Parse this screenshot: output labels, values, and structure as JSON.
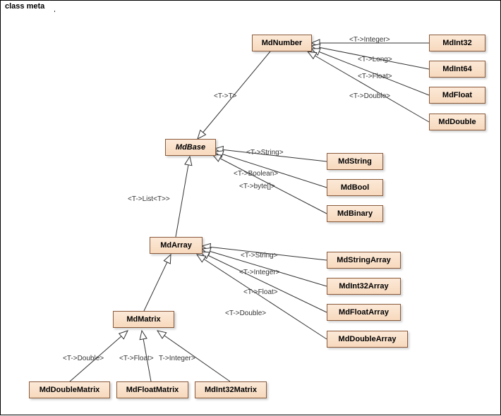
{
  "frame": {
    "title": "class meta"
  },
  "classes": {
    "mdnumber": "MdNumber",
    "mdint32": "MdInt32",
    "mdint64": "MdInt64",
    "mdfloat": "MdFloat",
    "mddouble": "MdDouble",
    "mdbase": "MdBase",
    "mdstring": "MdString",
    "mdbool": "MdBool",
    "mdbinary": "MdBinary",
    "mdarray": "MdArray",
    "mdstringarray": "MdStringArray",
    "mdint32array": "MdInt32Array",
    "mdfloatarray": "MdFloatArray",
    "mddoublearray": "MdDoubleArray",
    "mdmatrix": "MdMatrix",
    "mddoublematrix": "MdDoubleMatrix",
    "mdfloatmatrix": "MdFloatMatrix",
    "mdint32matrix": "MdInt32Matrix"
  },
  "labels": {
    "t_integer": "<T->Integer>",
    "t_long": "<T->Long>",
    "t_float": "<T->Float>",
    "t_double": "<T->Double>",
    "t_t": "<T->T>",
    "t_string": "<T->String>",
    "t_boolean": "<T->Boolean>",
    "t_byte": "<T->byte[]>",
    "t_list_t": "<T->List<T>>",
    "t_string2": "<T->String>",
    "t_integer2": "<T->Integer>",
    "t_float2": "<T->Float>",
    "t_double2": "<T->Double>",
    "t_double3": "<T->Double>",
    "t_float3": "<T->Float>",
    "t_integer3": "T->Integer>"
  },
  "chart_data": {
    "type": "diagram",
    "diagram_type": "uml_class",
    "title": "class meta",
    "nodes": [
      {
        "id": "MdBase",
        "abstract": true
      },
      {
        "id": "MdNumber"
      },
      {
        "id": "MdInt32"
      },
      {
        "id": "MdInt64"
      },
      {
        "id": "MdFloat"
      },
      {
        "id": "MdDouble"
      },
      {
        "id": "MdString"
      },
      {
        "id": "MdBool"
      },
      {
        "id": "MdBinary"
      },
      {
        "id": "MdArray"
      },
      {
        "id": "MdStringArray"
      },
      {
        "id": "MdInt32Array"
      },
      {
        "id": "MdFloatArray"
      },
      {
        "id": "MdDoubleArray"
      },
      {
        "id": "MdMatrix"
      },
      {
        "id": "MdDoubleMatrix"
      },
      {
        "id": "MdFloatMatrix"
      },
      {
        "id": "MdInt32Matrix"
      }
    ],
    "edges": [
      {
        "from": "MdNumber",
        "to": "MdBase",
        "label": "<T->T>",
        "relation": "generalization"
      },
      {
        "from": "MdInt32",
        "to": "MdNumber",
        "label": "<T->Integer>",
        "relation": "generalization"
      },
      {
        "from": "MdInt64",
        "to": "MdNumber",
        "label": "<T->Long>",
        "relation": "generalization"
      },
      {
        "from": "MdFloat",
        "to": "MdNumber",
        "label": "<T->Float>",
        "relation": "generalization"
      },
      {
        "from": "MdDouble",
        "to": "MdNumber",
        "label": "<T->Double>",
        "relation": "generalization"
      },
      {
        "from": "MdString",
        "to": "MdBase",
        "label": "<T->String>",
        "relation": "generalization"
      },
      {
        "from": "MdBool",
        "to": "MdBase",
        "label": "<T->Boolean>",
        "relation": "generalization"
      },
      {
        "from": "MdBinary",
        "to": "MdBase",
        "label": "<T->byte[]>",
        "relation": "generalization"
      },
      {
        "from": "MdArray",
        "to": "MdBase",
        "label": "<T->List<T>>",
        "relation": "generalization"
      },
      {
        "from": "MdStringArray",
        "to": "MdArray",
        "label": "<T->String>",
        "relation": "generalization"
      },
      {
        "from": "MdInt32Array",
        "to": "MdArray",
        "label": "<T->Integer>",
        "relation": "generalization"
      },
      {
        "from": "MdFloatArray",
        "to": "MdArray",
        "label": "<T->Float>",
        "relation": "generalization"
      },
      {
        "from": "MdDoubleArray",
        "to": "MdArray",
        "label": "<T->Double>",
        "relation": "generalization"
      },
      {
        "from": "MdMatrix",
        "to": "MdArray",
        "relation": "generalization"
      },
      {
        "from": "MdDoubleMatrix",
        "to": "MdMatrix",
        "label": "<T->Double>",
        "relation": "generalization"
      },
      {
        "from": "MdFloatMatrix",
        "to": "MdMatrix",
        "label": "<T->Float>",
        "relation": "generalization"
      },
      {
        "from": "MdInt32Matrix",
        "to": "MdMatrix",
        "label": "T->Integer>",
        "relation": "generalization"
      }
    ]
  }
}
